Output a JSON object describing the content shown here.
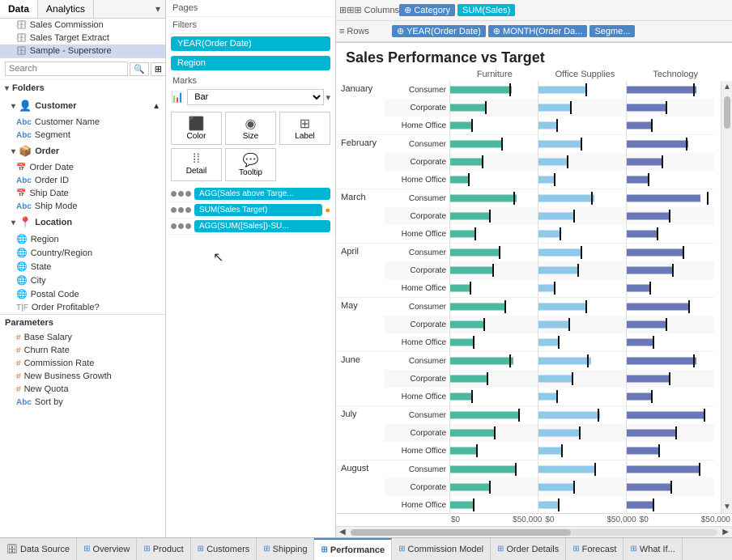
{
  "panels": {
    "left": {
      "tabs": [
        "Data",
        "Analytics"
      ],
      "active_tab": "Data",
      "search_placeholder": "Search",
      "folders": {
        "customer": {
          "label": "Customer",
          "items": [
            {
              "name": "Customer Name",
              "type": "abc"
            },
            {
              "name": "Segment",
              "type": "abc"
            }
          ]
        },
        "order": {
          "label": "Order",
          "items": [
            {
              "name": "Order Date",
              "type": "date"
            },
            {
              "name": "Order ID",
              "type": "abc"
            },
            {
              "name": "Ship Date",
              "type": "date"
            },
            {
              "name": "Ship Mode",
              "type": "abc"
            }
          ]
        },
        "location": {
          "label": "Location",
          "items": [
            {
              "name": "Region",
              "type": "globe"
            },
            {
              "name": "Country/Region",
              "type": "globe"
            },
            {
              "name": "State",
              "type": "globe"
            },
            {
              "name": "City",
              "type": "globe"
            },
            {
              "name": "Postal Code",
              "type": "globe"
            },
            {
              "name": "Order Profitable?",
              "type": "tf"
            }
          ]
        }
      },
      "data_sources": [
        {
          "name": "Sales Commission"
        },
        {
          "name": "Sales Target Extract"
        },
        {
          "name": "Sample - Superstore",
          "active": true
        }
      ],
      "parameters": {
        "label": "Parameters",
        "items": [
          {
            "name": "Base Salary",
            "type": "hash"
          },
          {
            "name": "Churn Rate",
            "type": "hash"
          },
          {
            "name": "Commission Rate",
            "type": "hash"
          },
          {
            "name": "New Business Growth",
            "type": "hash"
          },
          {
            "name": "New Quota",
            "type": "hash"
          },
          {
            "name": "Sort by",
            "type": "abc"
          }
        ]
      }
    },
    "middle": {
      "pages_label": "Pages",
      "filters_label": "Filters",
      "filters": [
        "YEAR(Order Date)",
        "Region"
      ],
      "marks_label": "Marks",
      "marks_type": "Bar",
      "marks_buttons": [
        {
          "label": "Color",
          "icon": "⬛"
        },
        {
          "label": "Size",
          "icon": "◉"
        },
        {
          "label": "Label",
          "icon": "⊞"
        },
        {
          "label": "Detail",
          "icon": "⁞⁞"
        },
        {
          "label": "Tooltip",
          "icon": "💬"
        }
      ],
      "pills": [
        {
          "text": "AGG(Sales above Targe...",
          "type": "teal",
          "dots": 3
        },
        {
          "text": "SUM(Sales Target)",
          "type": "teal",
          "dots": 3,
          "has_edit": true
        },
        {
          "text": "AGG(SUM([Sales])-SU...",
          "type": "teal",
          "dots": 3
        }
      ]
    }
  },
  "shelves": {
    "columns_label": "Columns",
    "columns_icon": "⊞",
    "columns_pills": [
      "⊕ Category",
      "SUM(Sales)"
    ],
    "rows_label": "Rows",
    "rows_icon": "≡",
    "rows_pills": [
      "⊕ YEAR(Order Date)",
      "⊕ MONTH(Order Da...",
      "Segme..."
    ]
  },
  "chart": {
    "title": "Sales Performance vs Target",
    "legend": [
      {
        "label": "Furniture",
        "color": "#4db8a0"
      },
      {
        "label": "Office Supplies",
        "color": "#8fc8e8"
      },
      {
        "label": "Technology",
        "color": "#6a78b8"
      }
    ],
    "months": [
      {
        "label": "January",
        "segments": [
          "Consumer",
          "Corporate",
          "Home Office"
        ],
        "bars": [
          {
            "f": 35,
            "o": 28,
            "t": 40,
            "tf": 34,
            "to": 27,
            "tt": 38
          },
          {
            "f": 20,
            "o": 18,
            "t": 22,
            "tf": 20,
            "to": 18,
            "tt": 22
          },
          {
            "f": 12,
            "o": 10,
            "t": 15,
            "tf": 12,
            "to": 10,
            "tt": 14
          }
        ]
      },
      {
        "label": "February",
        "segments": [
          "Consumer",
          "Corporate",
          "Home Office"
        ],
        "bars": [
          {
            "f": 30,
            "o": 25,
            "t": 35,
            "tf": 29,
            "to": 24,
            "tt": 34
          },
          {
            "f": 18,
            "o": 16,
            "t": 20,
            "tf": 18,
            "to": 16,
            "tt": 20
          },
          {
            "f": 10,
            "o": 9,
            "t": 12,
            "tf": 10,
            "to": 9,
            "tt": 12
          }
        ]
      },
      {
        "label": "March",
        "segments": [
          "Consumer",
          "Corporate",
          "Home Office"
        ],
        "bars": [
          {
            "f": 38,
            "o": 32,
            "t": 42,
            "tf": 36,
            "to": 30,
            "tt": 46
          },
          {
            "f": 22,
            "o": 20,
            "t": 25,
            "tf": 22,
            "to": 20,
            "tt": 24
          },
          {
            "f": 14,
            "o": 12,
            "t": 18,
            "tf": 14,
            "to": 12,
            "tt": 17
          }
        ]
      },
      {
        "label": "April",
        "segments": [
          "Consumer",
          "Corporate",
          "Home Office"
        ],
        "bars": [
          {
            "f": 28,
            "o": 24,
            "t": 32,
            "tf": 28,
            "to": 24,
            "tt": 32
          },
          {
            "f": 24,
            "o": 22,
            "t": 27,
            "tf": 24,
            "to": 22,
            "tt": 26
          },
          {
            "f": 11,
            "o": 9,
            "t": 13,
            "tf": 11,
            "to": 9,
            "tt": 13
          }
        ]
      },
      {
        "label": "May",
        "segments": [
          "Consumer",
          "Corporate",
          "Home Office"
        ],
        "bars": [
          {
            "f": 32,
            "o": 28,
            "t": 36,
            "tf": 31,
            "to": 27,
            "tt": 35
          },
          {
            "f": 19,
            "o": 17,
            "t": 22,
            "tf": 19,
            "to": 17,
            "tt": 22
          },
          {
            "f": 13,
            "o": 11,
            "t": 15,
            "tf": 13,
            "to": 11,
            "tt": 15
          }
        ]
      },
      {
        "label": "June",
        "segments": [
          "Consumer",
          "Corporate",
          "Home Office"
        ],
        "bars": [
          {
            "f": 36,
            "o": 30,
            "t": 40,
            "tf": 34,
            "to": 28,
            "tt": 38
          },
          {
            "f": 21,
            "o": 19,
            "t": 24,
            "tf": 21,
            "to": 19,
            "tt": 24
          },
          {
            "f": 12,
            "o": 10,
            "t": 14,
            "tf": 12,
            "to": 10,
            "tt": 14
          }
        ]
      },
      {
        "label": "July",
        "segments": [
          "Consumer",
          "Corporate",
          "Home Office"
        ],
        "bars": [
          {
            "f": 40,
            "o": 35,
            "t": 45,
            "tf": 39,
            "to": 34,
            "tt": 44
          },
          {
            "f": 25,
            "o": 23,
            "t": 28,
            "tf": 25,
            "to": 23,
            "tt": 28
          },
          {
            "f": 15,
            "o": 13,
            "t": 18,
            "tf": 15,
            "to": 13,
            "tt": 18
          }
        ]
      },
      {
        "label": "August",
        "segments": [
          "Consumer",
          "Corporate",
          "Home Office"
        ],
        "bars": [
          {
            "f": 38,
            "o": 33,
            "t": 42,
            "tf": 37,
            "to": 32,
            "tt": 41
          },
          {
            "f": 22,
            "o": 20,
            "t": 25,
            "tf": 22,
            "to": 20,
            "tt": 25
          },
          {
            "f": 13,
            "o": 11,
            "t": 15,
            "tf": 13,
            "to": 11,
            "tt": 15
          }
        ]
      }
    ],
    "x_axis": [
      "$0",
      "$50,000",
      "$0",
      "$50,000",
      "$0",
      "$50,000"
    ]
  },
  "bottom_tabs": [
    {
      "label": "Data Source",
      "icon": "⊞",
      "is_datasource": true
    },
    {
      "label": "Overview",
      "icon": "⊞"
    },
    {
      "label": "Product",
      "icon": "⊞"
    },
    {
      "label": "Customers",
      "icon": "⊞"
    },
    {
      "label": "Shipping",
      "icon": "⊞"
    },
    {
      "label": "Performance",
      "icon": "⊞",
      "active": true
    },
    {
      "label": "Commission Model",
      "icon": "⊞"
    },
    {
      "label": "Order Details",
      "icon": "⊞"
    },
    {
      "label": "Forecast",
      "icon": "⊞"
    },
    {
      "label": "What If...",
      "icon": "⊞"
    }
  ]
}
